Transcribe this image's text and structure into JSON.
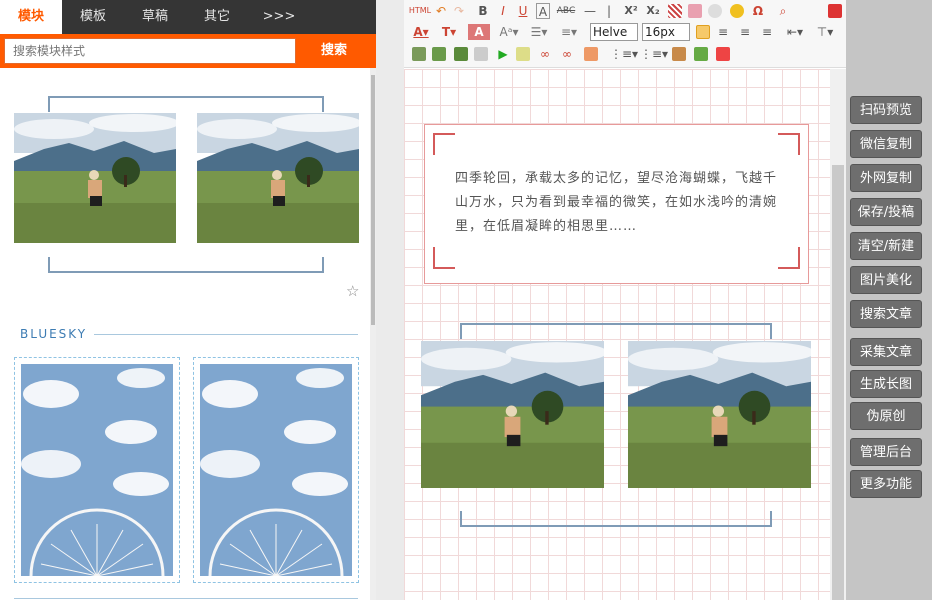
{
  "tabs": [
    "模块",
    "模板",
    "草稿",
    "其它",
    ">>>"
  ],
  "search": {
    "placeholder": "搜索模块样式",
    "button": "搜索"
  },
  "bluesky_label": "BLUESKY",
  "toolbar": {
    "font_family": "Helve",
    "font_size": "16px",
    "buttons": [
      "HTML",
      "B",
      "I",
      "U",
      "A",
      "ABC",
      "—",
      "|",
      "X²",
      "X₂",
      "Ω"
    ]
  },
  "editor": {
    "poem": "四季轮回，承载太多的记忆，望尽沧海蝴蝶，飞越千山万水，只为看到最幸福的微笑，在如水浅吟的清婉里，在低眉凝眸的相思里……"
  },
  "right_buttons": [
    "扫码预览",
    "微信复制",
    "外网复制",
    "保存/投稿",
    "清空/新建",
    "图片美化",
    "搜索文章",
    "采集文章",
    "生成长图",
    "伪原创",
    "管理后台",
    "更多功能"
  ],
  "colors": {
    "accent": "#ff5a00",
    "bracket": "#7f9bb6",
    "poem_border": "#e79a9a"
  }
}
